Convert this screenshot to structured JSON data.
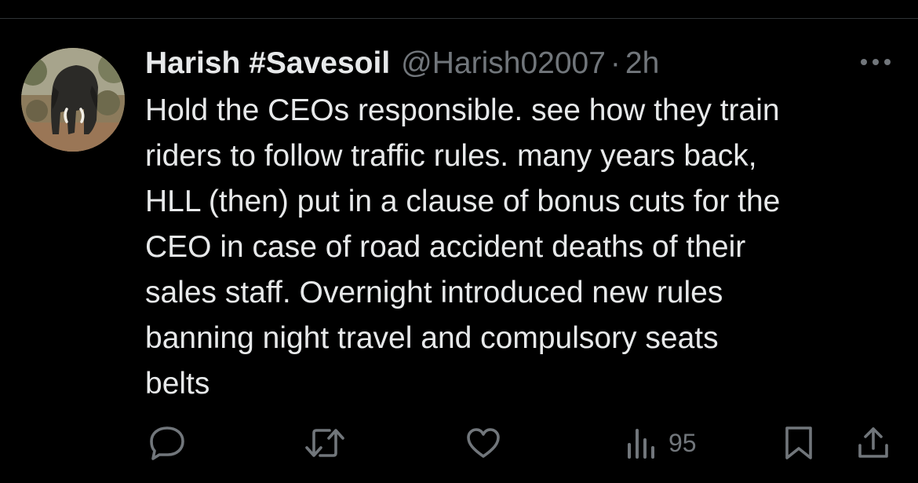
{
  "tweet": {
    "display_name": "Harish #Savesoil",
    "handle": "@Harish02007",
    "separator": "·",
    "timestamp": "2h",
    "text": "Hold the CEOs responsible. see how they train\nriders to follow traffic rules. many years back,\nHLL (then) put in a clause of bonus cuts for the\nCEO in case of road accident deaths of their\nsales staff. Overnight introduced new rules\nbanning night travel and compulsory seats\nbelts"
  },
  "avatar": {
    "icon": "elephant-avatar"
  },
  "actions": {
    "reply_icon": "reply-icon",
    "retweet_icon": "retweet-icon",
    "like_icon": "heart-icon",
    "views_icon": "views-icon",
    "views_count": "95",
    "bookmark_icon": "bookmark-icon",
    "share_icon": "share-icon"
  },
  "colors": {
    "background": "#000000",
    "primary_text": "#e7e9ea",
    "secondary_text": "#71767b",
    "divider": "#2f3336"
  }
}
